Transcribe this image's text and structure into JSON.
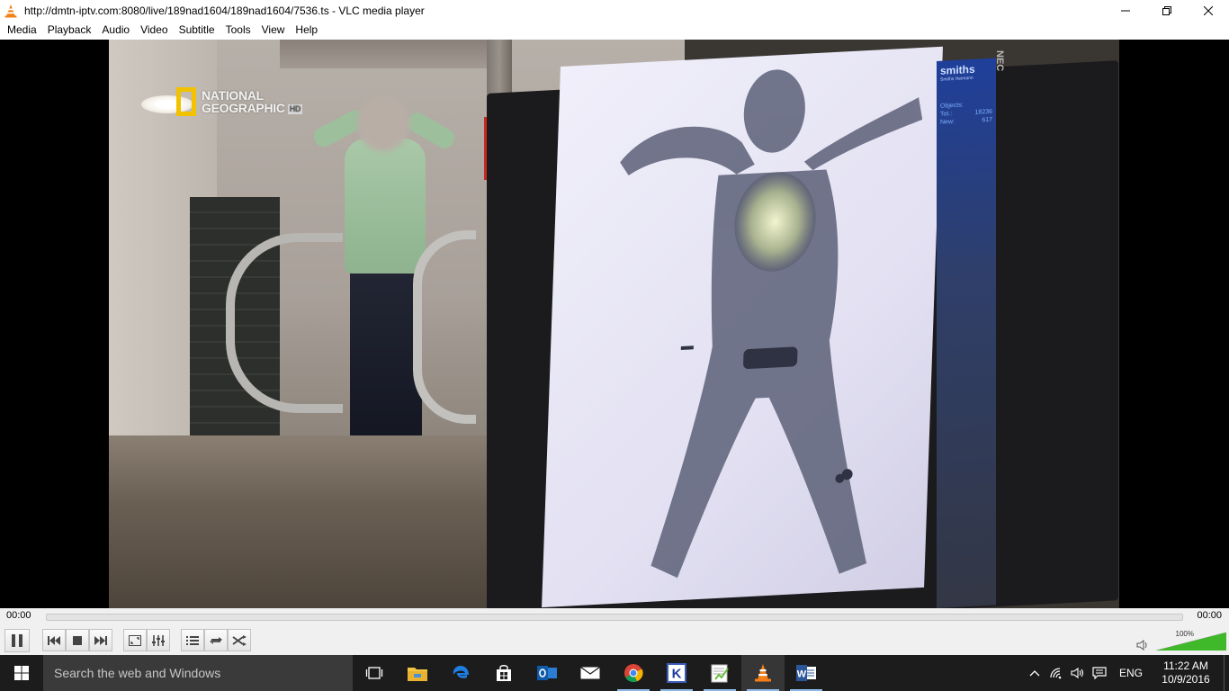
{
  "window": {
    "title": "http://dmtn-iptv.com:8080/live/189nad1604/189nad1604/7536.ts - VLC media player"
  },
  "menu": [
    "Media",
    "Playback",
    "Audio",
    "Video",
    "Subtitle",
    "Tools",
    "View",
    "Help"
  ],
  "video": {
    "logo_line1": "NATIONAL",
    "logo_line2": "GEOGRAPHIC",
    "logo_hd": "HD",
    "screen_brand": "smiths",
    "screen_sub": "Smiths Heimann",
    "screen_objects_label": "Objects:",
    "screen_tot_label": "Tot.:",
    "screen_tot_value": "18236",
    "screen_new_label": "New:",
    "screen_new_value": "617",
    "monitor_brand": "NEC"
  },
  "playback": {
    "elapsed": "00:00",
    "total": "00:00",
    "progress": 0
  },
  "volume": {
    "percent_label": "100%",
    "level": 1.0
  },
  "taskbar": {
    "search_placeholder": "Search the web and Windows",
    "apps": [
      "task-view",
      "file-explorer",
      "edge",
      "store",
      "outlook",
      "mail",
      "chrome",
      "k-app",
      "notepad-plus",
      "vlc",
      "word"
    ],
    "language": "ENG",
    "time": "11:22 AM",
    "date": "10/9/2016"
  },
  "colors": {
    "seek_fill": "#7ebc57",
    "taskbar": "#1c1c1c",
    "vlc_orange": "#f57f17"
  }
}
